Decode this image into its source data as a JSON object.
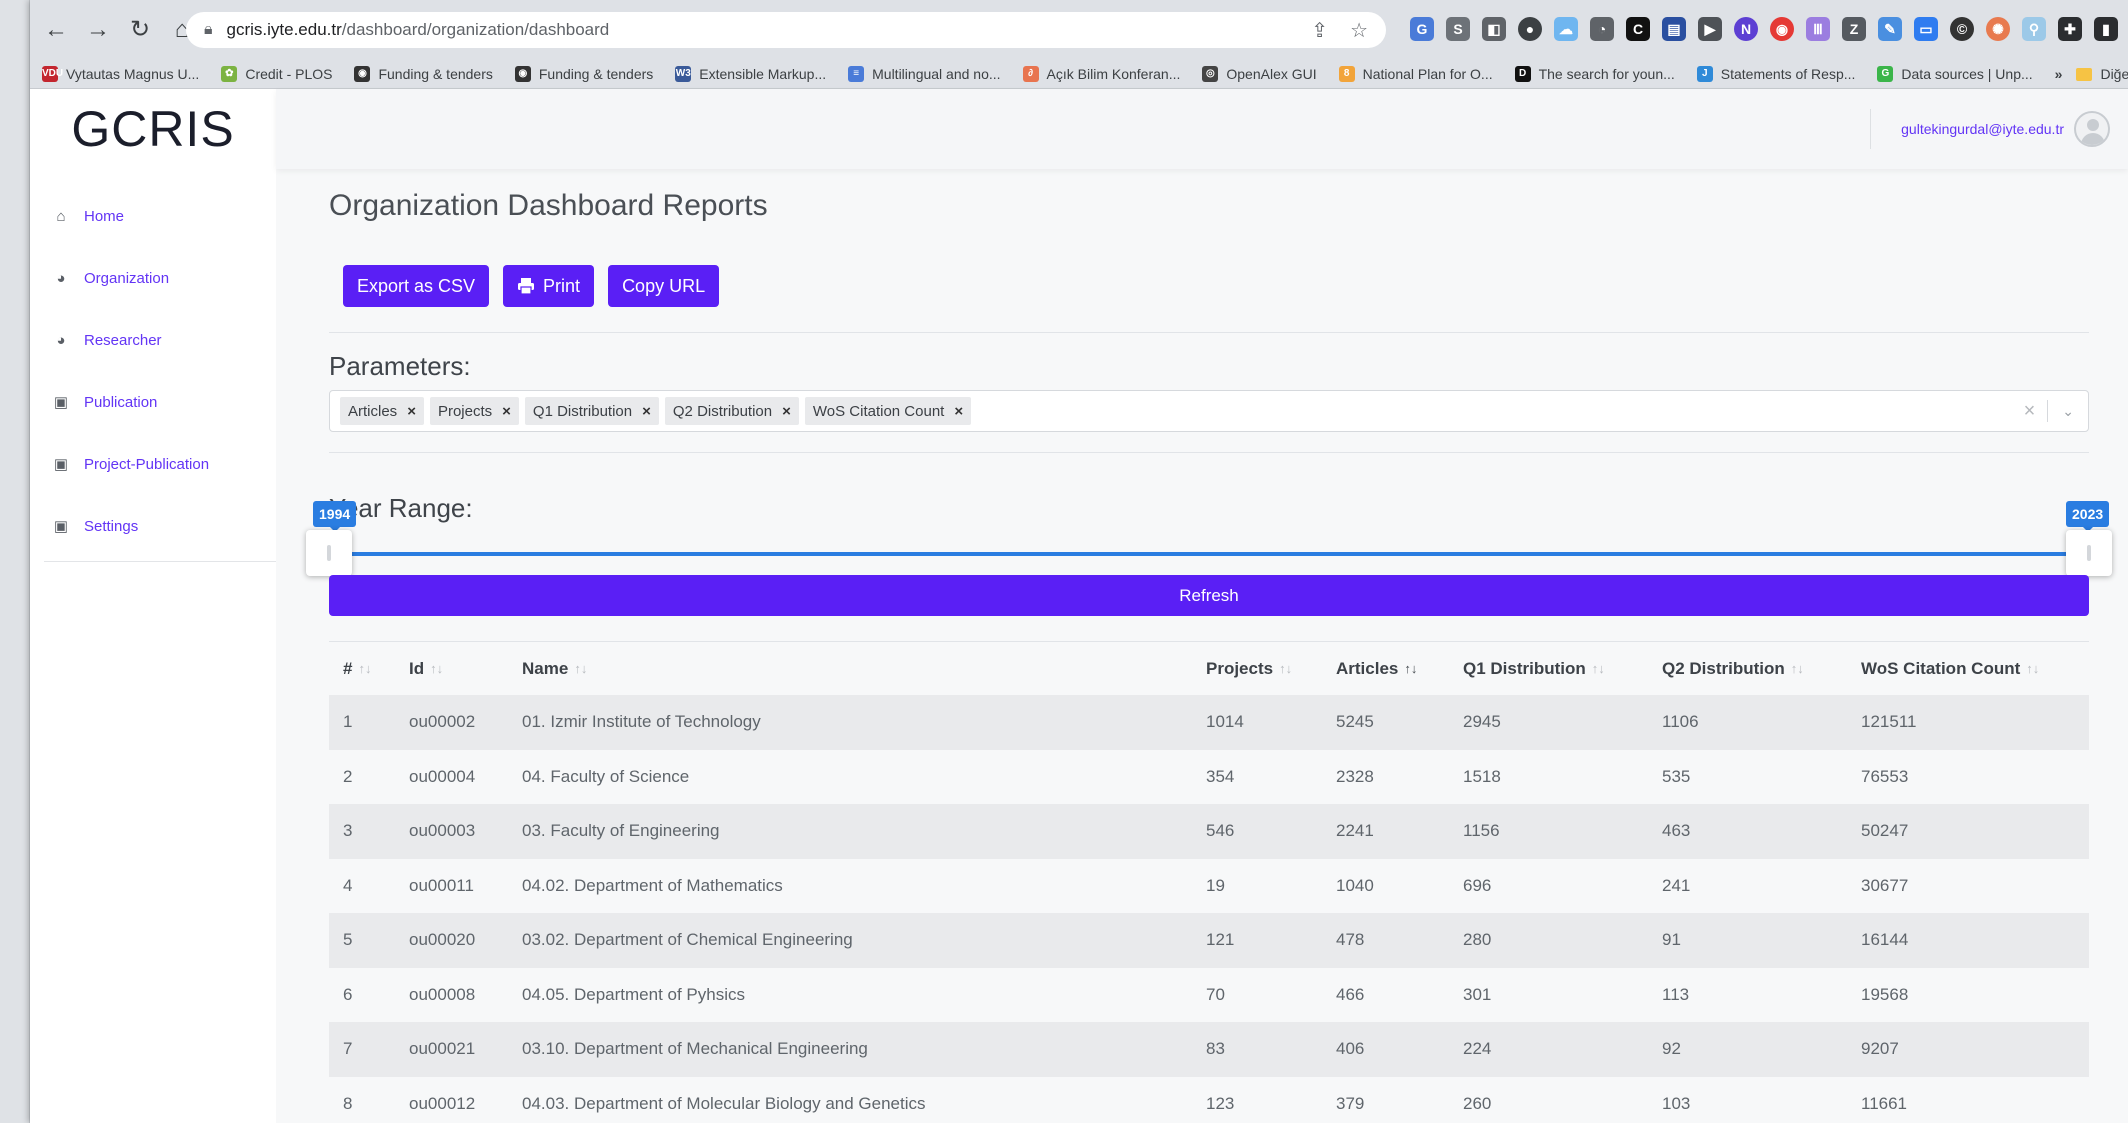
{
  "browser": {
    "url_host": "gcris.iyte.edu.tr",
    "url_path": "/dashboard/organization/dashboard",
    "bookmarks": [
      {
        "label": "Vytautas Magnus U...",
        "color": "#c3262f",
        "glyph": "VDU"
      },
      {
        "label": "Credit - PLOS",
        "color": "#7cb342",
        "glyph": "✿"
      },
      {
        "label": "Funding & tenders",
        "color": "#333333",
        "glyph": "◉"
      },
      {
        "label": "Funding & tenders",
        "color": "#333333",
        "glyph": "◉"
      },
      {
        "label": "Extensible Markup...",
        "color": "#3a5a99",
        "glyph": "W3"
      },
      {
        "label": "Multilingual and no...",
        "color": "#4a7bd8",
        "glyph": "≡"
      },
      {
        "label": "Açık Bilim Konferan...",
        "color": "#e8744f",
        "glyph": "∂"
      },
      {
        "label": "OpenAlex GUI",
        "color": "#444444",
        "glyph": "◎"
      },
      {
        "label": "National Plan for O...",
        "color": "#f2a43a",
        "glyph": "8"
      },
      {
        "label": "The search for youn...",
        "color": "#111111",
        "glyph": "D"
      },
      {
        "label": "Statements of Resp...",
        "color": "#2f8ad8",
        "glyph": "J"
      },
      {
        "label": "Data sources | Unp...",
        "color": "#3bb54a",
        "glyph": "G"
      }
    ],
    "bookmarks_more": "»",
    "other_bookmarks": "Diğer yer işare"
  },
  "app": {
    "logo": "GCRIS",
    "user_email": "gultekingurdal@iyte.edu.tr"
  },
  "sidebar": {
    "items": [
      {
        "label": "Home",
        "icon": "home-icon"
      },
      {
        "label": "Organization",
        "icon": "pie-chart-icon"
      },
      {
        "label": "Researcher",
        "icon": "pie-chart-icon"
      },
      {
        "label": "Publication",
        "icon": "book-icon"
      },
      {
        "label": "Project-Publication",
        "icon": "book-icon"
      },
      {
        "label": "Settings",
        "icon": "book-icon"
      }
    ]
  },
  "main": {
    "title": "Organization Dashboard Reports",
    "buttons": {
      "export": "Export as CSV",
      "print": "Print",
      "copy_url": "Copy URL"
    },
    "parameters_label": "Parameters:",
    "parameters": [
      "Articles",
      "Projects",
      "Q1 Distribution",
      "Q2 Distribution",
      "WoS Citation Count"
    ],
    "year_range_label": "Year Range:",
    "year_min": "1994",
    "year_max": "2023",
    "refresh": "Refresh"
  },
  "table": {
    "headers": {
      "num": "#",
      "id": "Id",
      "name": "Name",
      "projects": "Projects",
      "articles": "Articles",
      "q1": "Q1 Distribution",
      "q2": "Q2 Distribution",
      "wos": "WoS Citation Count"
    },
    "rows": [
      {
        "num": "1",
        "id": "ou00002",
        "name": "01. Izmir Institute of Technology",
        "projects": "1014",
        "articles": "5245",
        "q1": "2945",
        "q2": "1106",
        "wos": "121511"
      },
      {
        "num": "2",
        "id": "ou00004",
        "name": "04. Faculty of Science",
        "projects": "354",
        "articles": "2328",
        "q1": "1518",
        "q2": "535",
        "wos": "76553"
      },
      {
        "num": "3",
        "id": "ou00003",
        "name": "03. Faculty of Engineering",
        "projects": "546",
        "articles": "2241",
        "q1": "1156",
        "q2": "463",
        "wos": "50247"
      },
      {
        "num": "4",
        "id": "ou00011",
        "name": "04.02. Department of Mathematics",
        "projects": "19",
        "articles": "1040",
        "q1": "696",
        "q2": "241",
        "wos": "30677"
      },
      {
        "num": "5",
        "id": "ou00020",
        "name": "03.02. Department of Chemical Engineering",
        "projects": "121",
        "articles": "478",
        "q1": "280",
        "q2": "91",
        "wos": "16144"
      },
      {
        "num": "6",
        "id": "ou00008",
        "name": "04.05. Department of Pyhsics",
        "projects": "70",
        "articles": "466",
        "q1": "301",
        "q2": "113",
        "wos": "19568"
      },
      {
        "num": "7",
        "id": "ou00021",
        "name": "03.10. Department of Mechanical Engineering",
        "projects": "83",
        "articles": "406",
        "q1": "224",
        "q2": "92",
        "wos": "9207"
      },
      {
        "num": "8",
        "id": "ou00012",
        "name": "04.03. Department of Molecular Biology and Genetics",
        "projects": "123",
        "articles": "379",
        "q1": "260",
        "q2": "103",
        "wos": "11661"
      }
    ]
  }
}
